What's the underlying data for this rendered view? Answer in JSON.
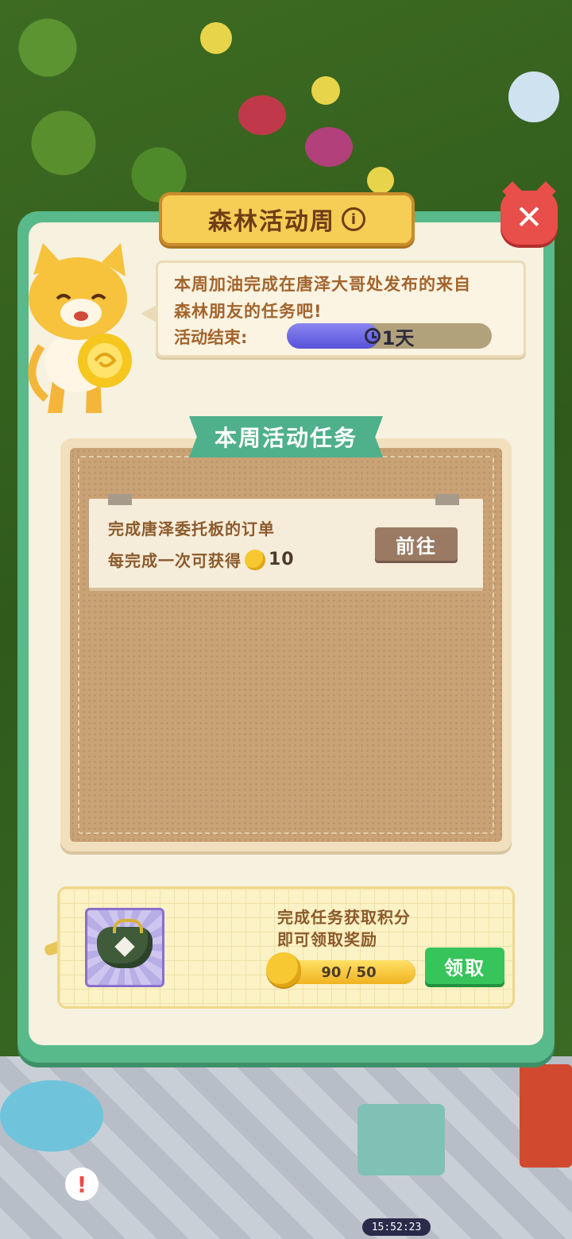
{
  "header": {
    "title": "森林活动周",
    "info_icon": "info-icon",
    "close_icon": "close-icon"
  },
  "intro": {
    "line1": "本周加油完成在唐泽大哥处发布的来自",
    "line2": "森林朋友的任务吧!",
    "end_label": "活动结束:",
    "timer_text": "1天",
    "timer_icon": "clock-icon",
    "timer_fill_fraction": 0.45
  },
  "tasks_section": {
    "title": "本周活动任务",
    "tasks": [
      {
        "title": "完成唐泽委托板的订单",
        "reward_prefix": "每完成一次可获得",
        "reward_icon": "chick-coin-icon",
        "reward_amount": "10",
        "go_label": "前往"
      }
    ]
  },
  "reward": {
    "line1": "完成任务获取积分",
    "line2": "即可领取奖励",
    "points_text": "90 / 50",
    "points_fill_fraction": 1.0,
    "claim_label": "领取",
    "reward_item_icon": "purse-icon",
    "points_icon": "chick-coin-icon"
  },
  "status": {
    "clock": "15:52:23"
  },
  "colors": {
    "panel_green": "#58b98a",
    "title_gold": "#f6cd55",
    "close_red": "#e84e4a",
    "claim_green": "#37c45a",
    "timer_purple": "#5752d9"
  }
}
